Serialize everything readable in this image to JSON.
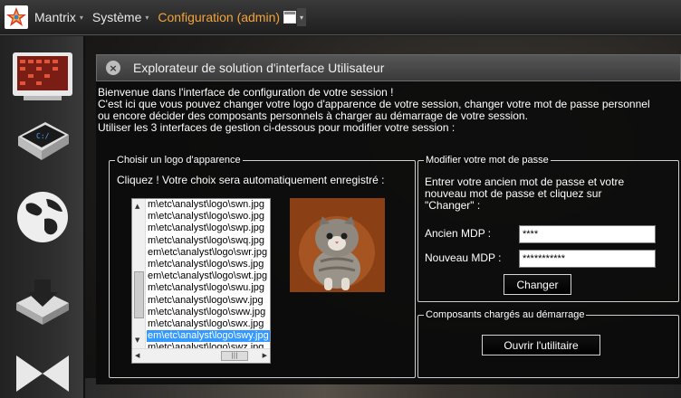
{
  "menubar": {
    "logo_icon": "mantrix-star-icon",
    "items": [
      {
        "label": "Mantrix",
        "caret": "▾"
      },
      {
        "label": "Système",
        "caret": "▾"
      },
      {
        "label": "Configuration (admin)",
        "caret": ""
      }
    ],
    "active_color": "#f3a43b",
    "window_caret": "▾"
  },
  "sidebar": {
    "icons": [
      "dashboard-screen-icon",
      "terminal-icon",
      "globe-icon",
      "download-icon",
      "bowtie-icon"
    ]
  },
  "panel": {
    "close_glyph": "×",
    "title": "Explorateur de solution d'interface Utilisateur",
    "intro": [
      "Bienvenue dans l'interface de configuration de votre session !",
      "C'est ici que vous pouvez changer votre logo d'apparence de votre session, changer votre mot de passe personnel",
      "ou encore décider des composants personnels à charger au démarrage de votre session.",
      "Utiliser les 3 interfaces de gestion ci-dessous pour modifier votre session :"
    ]
  },
  "logo_group": {
    "label": "Choisir un logo d'apparence",
    "hint": "Cliquez ! Votre choix sera automatiquement enregistré :",
    "files": [
      "m\\etc\\analyst\\logo\\swn.jpg",
      "m\\etc\\analyst\\logo\\swo.jpg",
      "m\\etc\\analyst\\logo\\swp.jpg",
      "m\\etc\\analyst\\logo\\swq.jpg",
      "em\\etc\\analyst\\logo\\swr.jpg",
      "m\\etc\\analyst\\logo\\sws.jpg",
      "em\\etc\\analyst\\logo\\swt.jpg",
      "m\\etc\\analyst\\logo\\swu.jpg",
      "m\\etc\\analyst\\logo\\swv.jpg",
      "m\\etc\\analyst\\logo\\sww.jpg",
      "m\\etc\\analyst\\logo\\swx.jpg",
      "em\\etc\\analyst\\logo\\swy.jpg",
      "m\\etc\\analyst\\logo\\swz.jpg"
    ],
    "selected_index": 11,
    "preview_icon": "kitten-photo"
  },
  "password_group": {
    "label": "Modifier votre mot de passe",
    "instructions": [
      "Entrer votre ancien mot de passe et votre",
      "nouveau mot de passe et cliquez sur",
      "\"Changer\" :"
    ],
    "old_label": "Ancien MDP :",
    "old_value": "****",
    "new_label": "Nouveau MDP :",
    "new_value": "***********",
    "button": "Changer"
  },
  "components_group": {
    "label": "Composants chargés au démarrage",
    "button": "Ouvrir l'utilitaire"
  }
}
